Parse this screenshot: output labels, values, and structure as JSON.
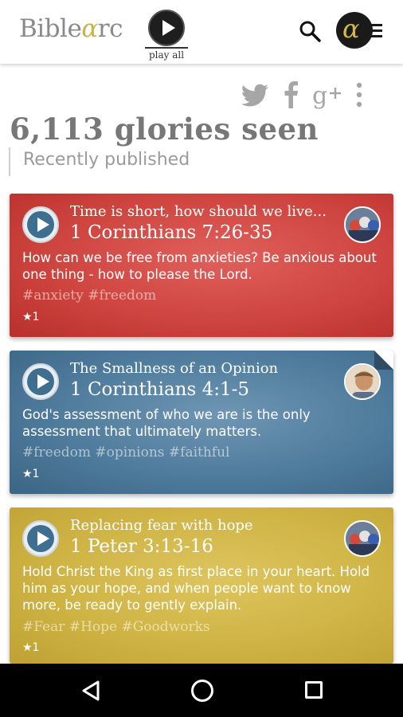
{
  "header": {
    "logo_prefix": "Bible",
    "logo_alpha": "α",
    "logo_suffix": "rc",
    "play_all_label": "play all",
    "menu_logo": "α"
  },
  "share": {
    "icons": [
      "twitter-icon",
      "facebook-icon",
      "google-plus-icon",
      "more-vert-icon"
    ]
  },
  "stats": {
    "glories_seen": "6,113 glories seen"
  },
  "section": {
    "title": "Recently published"
  },
  "cards": [
    {
      "subtitle": "Time is short, how should we live...",
      "reference": "1 Corinthians 7:26-35",
      "description": "How can we be free from anxieties? Be anxious about one thing - how to please the Lord.",
      "tags": "#anxiety #freedom",
      "stars": "★1",
      "color": "#cf4540"
    },
    {
      "subtitle": "The Smallness of an Opinion",
      "reference": "1 Corinthians 4:1-5",
      "description": "God's assessment of who we are is the only assessment that ultimately matters.",
      "tags": "#freedom #opinions #faithful",
      "stars": "★1",
      "color": "#4f7b9c"
    },
    {
      "subtitle": "Replacing fear with hope",
      "reference": "1 Peter 3:13-16",
      "description": "Hold Christ the King as first place in your heart. Hold him as your hope, and when people want to know more, be ready to gently explain.",
      "tags": "#Fear #Hope #Goodworks",
      "stars": "★1",
      "color": "#cfb445"
    }
  ],
  "navbar": {
    "icons": [
      "back-icon",
      "home-icon",
      "recents-icon"
    ]
  }
}
